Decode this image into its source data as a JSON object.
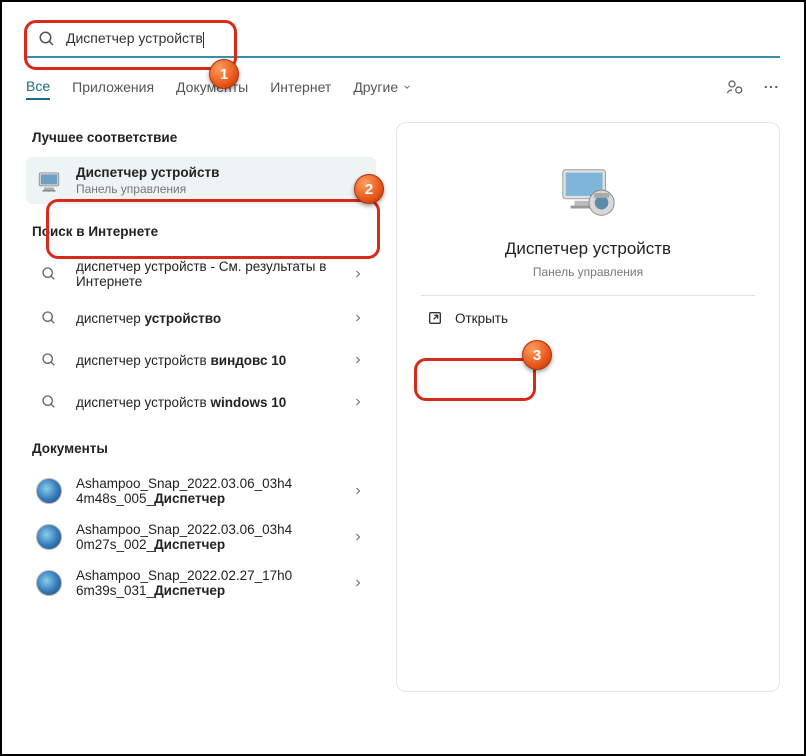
{
  "search": {
    "value": "Диспетчер устройств"
  },
  "tabs": {
    "all": "Все",
    "apps": "Приложения",
    "docs": "Документы",
    "web": "Интернет",
    "more": "Другие"
  },
  "sections": {
    "bestMatch": "Лучшее соответствие",
    "webSearch": "Поиск в Интернете",
    "documents": "Документы"
  },
  "bestMatch": {
    "title": "Диспетчер устройств",
    "subtitle": "Панель управления"
  },
  "web": [
    {
      "prefix": "диспетчер устройств",
      "suffix": " - См. результаты в Интернете"
    },
    {
      "prefix": "диспетчер ",
      "bold": "устройство",
      "suffix": ""
    },
    {
      "prefix": "диспетчер устройств ",
      "bold": "виндовс 10",
      "suffix": ""
    },
    {
      "prefix": "диспетчер устройств ",
      "bold": "windows 10",
      "suffix": ""
    }
  ],
  "documents": [
    {
      "line1": "Ashampoo_Snap_2022.03.06_03h4",
      "line2_prefix": "4m48s_005_",
      "line2_bold": "Диспетчер"
    },
    {
      "line1": "Ashampoo_Snap_2022.03.06_03h4",
      "line2_prefix": "0m27s_002_",
      "line2_bold": "Диспетчер"
    },
    {
      "line1": "Ashampoo_Snap_2022.02.27_17h0",
      "line2_prefix": "6m39s_031_",
      "line2_bold": "Диспетчер"
    }
  ],
  "preview": {
    "title": "Диспетчер устройств",
    "subtitle": "Панель управления",
    "open": "Открыть"
  },
  "annotations": {
    "b1": "1",
    "b2": "2",
    "b3": "3"
  }
}
